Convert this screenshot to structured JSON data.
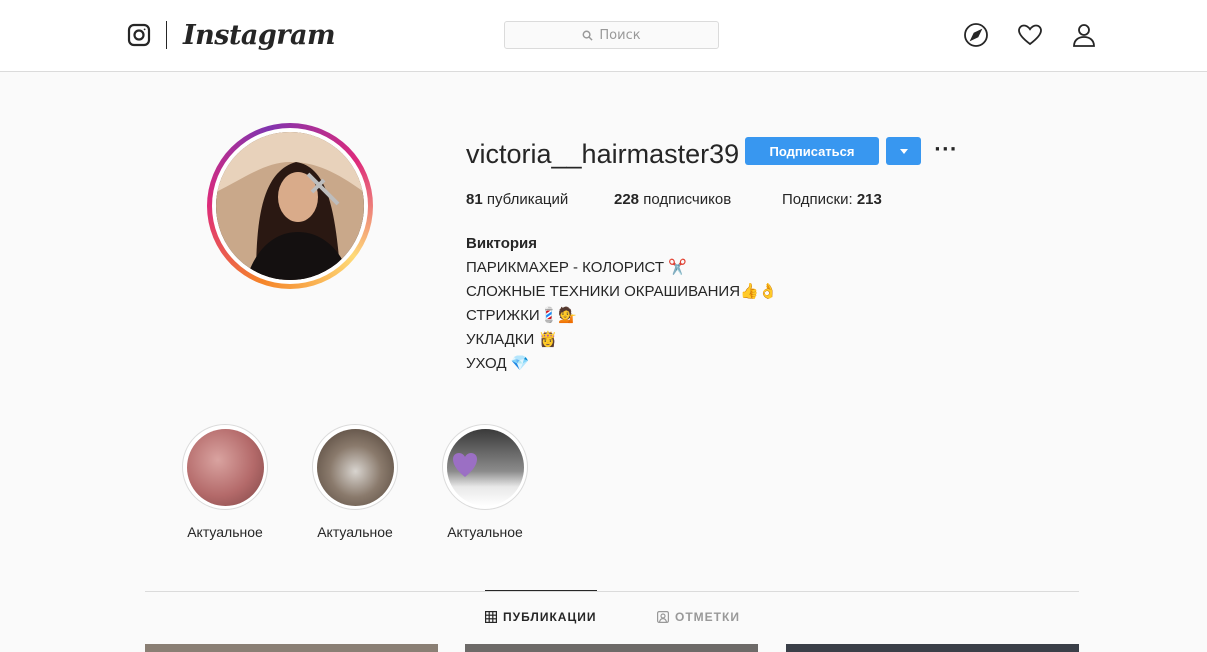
{
  "header": {
    "logo_icon": "instagram-glyph-icon",
    "wordmark": "Instagram",
    "search_placeholder": "Поиск",
    "nav_icons": [
      "compass-icon",
      "heart-icon",
      "user-icon"
    ]
  },
  "profile": {
    "username": "victoria__hairmaster39",
    "follow_label": "Подписаться",
    "stats": {
      "posts_count": "81",
      "posts_label": "публикаций",
      "followers_count": "228",
      "followers_label": "подписчиков",
      "following_label": "Подписки:",
      "following_count": "213"
    },
    "bio": {
      "name": "Виктория",
      "lines": [
        "ПАРИКМАХЕР - КОЛОРИСТ ✂️",
        "СЛОЖНЫЕ ТЕХНИКИ ОКРАШИВАНИЯ👍👌",
        "СТРИЖКИ💈💁",
        "УКЛАДКИ 👸",
        "УХОД 💎"
      ]
    }
  },
  "highlights": [
    {
      "label": "Актуальное"
    },
    {
      "label": "Актуальное"
    },
    {
      "label": "Актуальное"
    }
  ],
  "tabs": [
    {
      "label": "ПУБЛИКАЦИИ",
      "icon": "grid-icon",
      "active": true
    },
    {
      "label": "ОТМЕТКИ",
      "icon": "tagged-icon",
      "active": false
    }
  ],
  "colors": {
    "accent": "#3897f0",
    "border": "#dbdbdb",
    "text": "#262626"
  }
}
